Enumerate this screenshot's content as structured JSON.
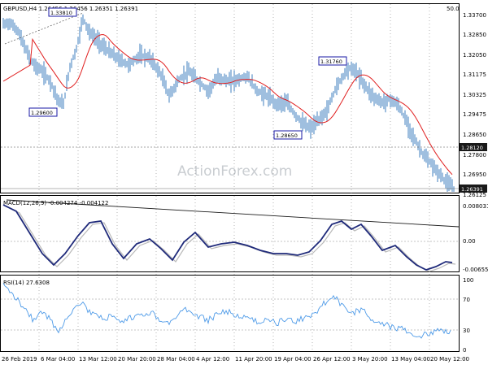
{
  "header": {
    "symbol_info": "GBPUSD,H4  1.26456 1.26456 1.26351 1.26391",
    "zoom": "50.0"
  },
  "watermark": "ActionForex.com",
  "price_axis": [
    "1.33700",
    "1.32850",
    "1.32050",
    "1.31175",
    "1.30325",
    "1.29475",
    "1.28650",
    "1.27800",
    "1.26950",
    "1.26125"
  ],
  "price_markers": {
    "level_tag": "1.28120",
    "current_tag": "1.26391"
  },
  "annotations": [
    "1.33810",
    "1.29600",
    "1.31760",
    "1.28650"
  ],
  "macd": {
    "label": "MACD(12,26,9) -0.004274 -0.004122",
    "axis": [
      "0.008031",
      "0.00",
      "-0.00655"
    ]
  },
  "rsi": {
    "label": "RSI(14) 27.6308",
    "axis": [
      "100",
      "70",
      "30",
      "0"
    ]
  },
  "time_axis": [
    "26 Feb 2019",
    "6 Mar 04:00",
    "13 Mar 12:00",
    "20 Mar 20:00",
    "28 Mar 04:00",
    "4 Apr 12:00",
    "11 Apr 20:00",
    "19 Apr 04:00",
    "26 Apr 12:00",
    "3 May 20:00",
    "13 May 04:00",
    "20 May 12:00"
  ],
  "colors": {
    "candle": "#3f7fbf",
    "ma": "#e02020",
    "macd_line": "#1f2a7a",
    "signal_line": "#b9b9b9",
    "rsi_line": "#4f9be8",
    "grid": "#6b6b6b",
    "tag_bg": "#1a1a1a",
    "tag_text": "#ffffff",
    "annotation_border": "#1a1aa6"
  }
}
